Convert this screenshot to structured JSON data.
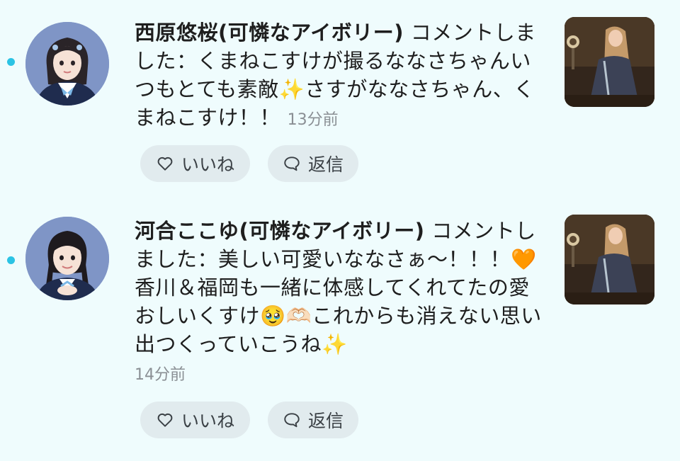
{
  "notifications": [
    {
      "user_name": "西原悠桜(可憐なアイボリー)",
      "action": " コメントしました：",
      "comment": "くまねこすけが撮るななさちゃんいつもとても素敵✨さすがななさちゃん、くまねこすけ！！",
      "time": "13分前",
      "like_label": "いいね",
      "reply_label": "返信",
      "unread": true
    },
    {
      "user_name": "河合ここゆ(可憐なアイボリー)",
      "action": " コメントしました：",
      "comment": "美しい可愛いななさぁ〜！！！🧡香川＆福岡も一緒に体感してくれてたの愛おしいくすけ🥹🫶🏻これからも消えない思い出つくっていこうね✨",
      "time": "14分前",
      "like_label": "いいね",
      "reply_label": "返信",
      "unread": true
    }
  ],
  "icons": {
    "like": "heart-outline-icon",
    "reply": "speech-bubble-icon"
  },
  "colors": {
    "background": "#effcfd",
    "unread_dot": "#2bc3e4",
    "button_bg": "#e1ebee",
    "timestamp": "#8a8f94"
  }
}
